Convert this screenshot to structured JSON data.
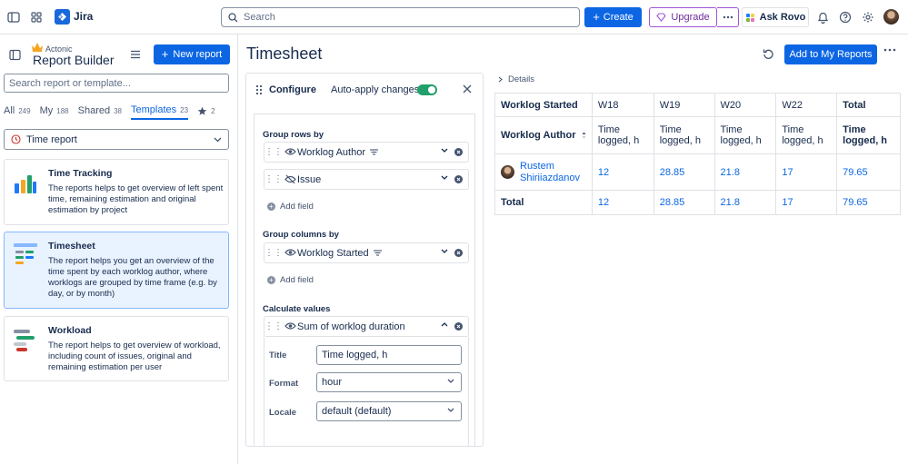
{
  "topnav": {
    "app_name": "Jira",
    "search_placeholder": "Search",
    "create_label": "Create",
    "upgrade_label": "Upgrade",
    "rovo_label": "Ask Rovo"
  },
  "sidebar": {
    "brand_small": "Actonic",
    "brand_title": "Report Builder",
    "new_report_label": "New report",
    "search_placeholder": "Search report or template...",
    "tabs": [
      {
        "label": "All",
        "count": "249"
      },
      {
        "label": "My",
        "count": "188"
      },
      {
        "label": "Shared",
        "count": "38"
      },
      {
        "label": "Templates",
        "count": "23"
      },
      {
        "label": "",
        "count": "2"
      }
    ],
    "select_value": "Time report",
    "cards": [
      {
        "title": "Time Tracking",
        "desc": "The reports helps to get overview of left spent time, remaining estimation and original estimation by project"
      },
      {
        "title": "Timesheet",
        "desc": "The report helps you get an overview of the time spent by each worklog author, where worklogs are grouped by time frame (e.g. by day, or by month)"
      },
      {
        "title": "Workload",
        "desc": "The report helps to get overview of workload, including count of issues, original and remaining estimation per user"
      }
    ]
  },
  "main": {
    "title": "Timesheet",
    "add_label": "Add to My Reports"
  },
  "config": {
    "title": "Configure",
    "auto_apply_label": "Auto-apply changes",
    "group_rows_label": "Group rows by",
    "group_rows": [
      "Worklog Author",
      "Issue"
    ],
    "add_field_label": "Add field",
    "group_columns_label": "Group columns by",
    "group_columns": [
      "Worklog Started"
    ],
    "calc_label": "Calculate values",
    "calc_field": "Sum of worklog duration",
    "prop_title_label": "Title",
    "prop_title_value": "Time logged, h",
    "prop_format_label": "Format",
    "prop_format_value": "hour",
    "prop_locale_label": "Locale",
    "prop_locale_value": "default (default)"
  },
  "report": {
    "details_label": "Details",
    "col_group_header": "Worklog Started",
    "weeks": [
      "W18",
      "W19",
      "W20",
      "W22",
      "Total"
    ],
    "row_group_header": "Worklog Author",
    "measure_label": "Time logged, h",
    "rows": [
      {
        "author": "Rustem Shiriiazdanov",
        "values": [
          "12",
          "28.85",
          "21.8",
          "17",
          "79.65"
        ]
      }
    ],
    "total_label": "Total",
    "totals": [
      "12",
      "28.85",
      "21.8",
      "17",
      "79.65"
    ]
  },
  "colors": {
    "primary": "#0c66e4",
    "selected_card": "#e9f2ff",
    "toggle_on": "#22a06b"
  }
}
